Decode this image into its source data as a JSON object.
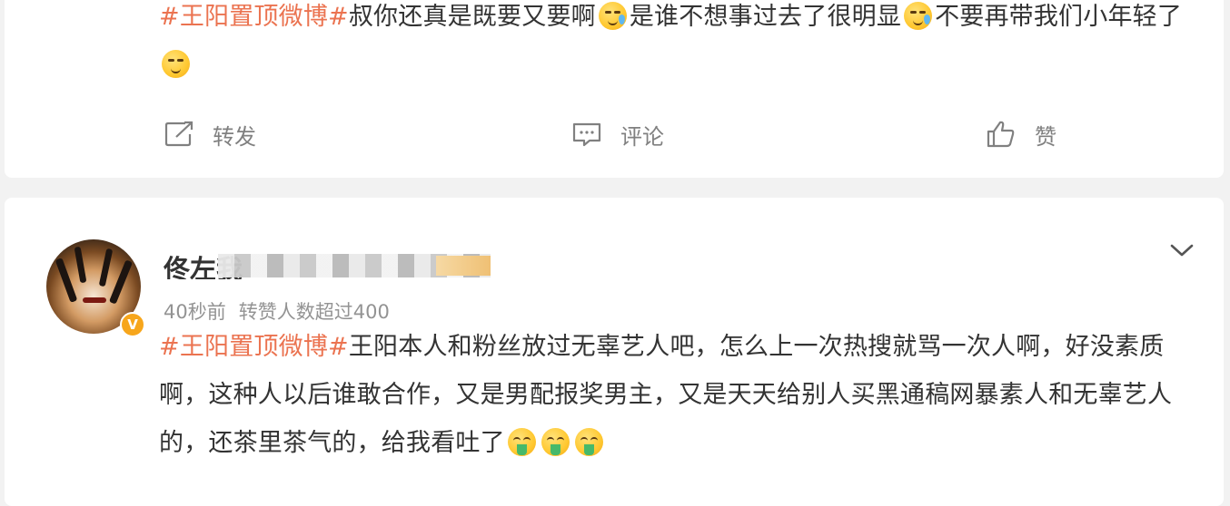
{
  "post_top": {
    "text_part1": "叔你还真是既要又要啊",
    "text_part2": "是谁不想事过去了很明显",
    "text_part3": "不要再带我们小年轻了",
    "hashtag": "#王阳置顶微博#",
    "actions": {
      "repost_label": "转发",
      "comment_label": "评论",
      "like_label": "赞"
    }
  },
  "comment": {
    "username_visible": "佟左我",
    "timestamp": "40秒前",
    "stats": "转赞人数超过400",
    "hashtag": "#王阳置顶微博#",
    "text": "王阳本人和粉丝放过无辜艺人吧，怎么上一次热搜就骂一次人啊，好没素质啊，这种人以后谁敢合作，又是男配报奖男主，又是天天给别人买黑通稿网暴素人和无辜艺人的，还茶里茶气的，给我看吐了",
    "badge_text": "V"
  },
  "colors": {
    "hashtag": "#eb7350",
    "text": "#333333",
    "meta": "#939393",
    "action": "#808080",
    "badge": "#f7a61c"
  },
  "icons": {
    "repost": "repost-icon",
    "comment": "comment-icon",
    "like": "thumbs-up-icon",
    "expand": "chevron-down-icon"
  }
}
